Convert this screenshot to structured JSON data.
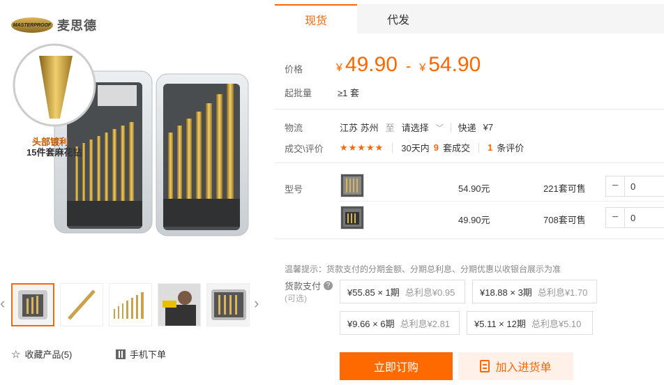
{
  "brand": {
    "badge": "MASTERPROOF",
    "name": "麦思德"
  },
  "product_image": {
    "callout_line1": "头部镀利",
    "callout_line2": "15件套麻花钻"
  },
  "gallery": {
    "thumb_count": 5
  },
  "actions": {
    "collect_label": "收藏产品(5)",
    "mobile_label": "手机下单"
  },
  "tabs": [
    {
      "label": "现货",
      "active": true
    },
    {
      "label": "代发",
      "active": false
    }
  ],
  "price": {
    "label": "价格",
    "currency": "¥",
    "low": "49.90",
    "separator": "-",
    "high": "54.90"
  },
  "moq": {
    "label": "起批量",
    "value": "≥1 套"
  },
  "logistics": {
    "label": "物流",
    "origin": "江苏 苏州",
    "to": "至",
    "destination": "请选择",
    "method": "快递",
    "fee": "¥7"
  },
  "reviews": {
    "label": "成交\\评价",
    "stars": "★★★★★",
    "sales_prefix": "30天内",
    "sales_count": "9",
    "sales_suffix": "套成交",
    "review_count": "1",
    "review_suffix": "条评价"
  },
  "models": {
    "label": "型号",
    "rows": [
      {
        "price": "54.90元",
        "stock": "221套可售",
        "qty": "0"
      },
      {
        "price": "49.90元",
        "stock": "708套可售",
        "qty": "0"
      }
    ]
  },
  "installment": {
    "tip": "温馨提示：货款支付的分期金额、分期总利息、分期优惠以收银台展示为准",
    "label": "货款支付",
    "help_icon": "?",
    "sublabel": "(可选)",
    "options": [
      {
        "amount": "¥55.85 × 1期",
        "fee": "总利息¥0.95"
      },
      {
        "amount": "¥18.88 × 3期",
        "fee": "总利息¥1.70"
      },
      {
        "amount": "¥9.66 × 6期",
        "fee": "总利息¥2.81"
      },
      {
        "amount": "¥5.11 × 12期",
        "fee": "总利息¥5.10"
      }
    ]
  },
  "buttons": {
    "order": "立即订购",
    "cart": "加入进货单"
  },
  "colors": {
    "accent": "#ff6600"
  }
}
